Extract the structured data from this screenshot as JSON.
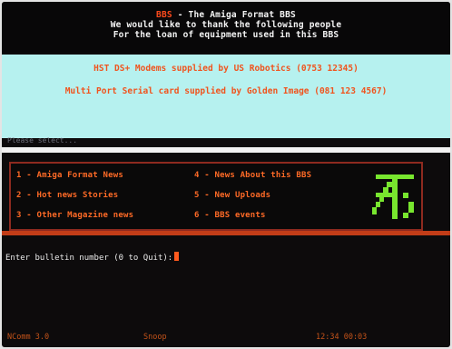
{
  "header": {
    "bbs_name": "BBS",
    "title_suffix": " - The Amiga Format BBS",
    "thanks_line": "We would like to thank the following people",
    "loan_line": "For the loan of equipment used in this BBS"
  },
  "sponsors": [
    "HST DS+ Modems supplied by US Robotics (0753 12345)",
    "Multi Port Serial card supplied by Golden Image (081 123 4567)"
  ],
  "please_text": "Please select...",
  "menu": {
    "items": [
      {
        "label": "1 - Amiga Format News"
      },
      {
        "label": "2 - Hot news Stories"
      },
      {
        "label": "3 - Other Magazine news"
      },
      {
        "label": "4 - News About this BBS"
      },
      {
        "label": "5 - New Uploads"
      },
      {
        "label": "6 - BBS events"
      }
    ],
    "logo": "amiga-format-logo"
  },
  "prompt": {
    "text": "Enter bulletin number (0 to Quit):"
  },
  "status": {
    "left": "NComm 3.0",
    "middle": "Snoop",
    "right": "12:34 00:03"
  },
  "colors": {
    "background": "#0d0b0c",
    "accent": "#ff6a26",
    "panel": "#b6f1ef"
  }
}
